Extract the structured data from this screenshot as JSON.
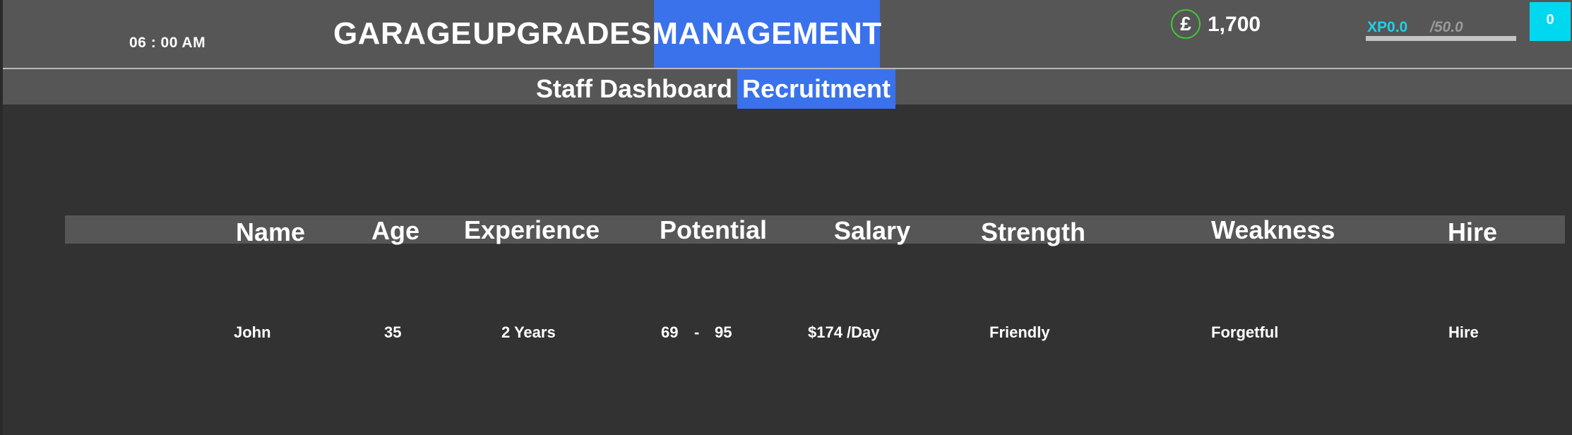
{
  "header": {
    "clock": "06 : 00 AM",
    "nav": [
      {
        "label": "GARAGE",
        "active": false
      },
      {
        "label": "UPGRADES",
        "active": false
      },
      {
        "label": "MANAGEMENT",
        "active": true
      }
    ],
    "currency_symbol": "£",
    "money": "1,700",
    "xp": {
      "label": "XP0.0",
      "max": "/50.0",
      "current": 0.0,
      "total": 50.0
    },
    "level": "0"
  },
  "subnav": [
    {
      "label": "Staff Dashboard",
      "active": false
    },
    {
      "label": "Recruitment",
      "active": true
    }
  ],
  "table": {
    "columns": [
      "Name",
      "Age",
      "Experience",
      "Potential",
      "Salary",
      "Strength",
      "Weakness",
      "Hire"
    ],
    "rows": [
      {
        "name": "John",
        "age": "35",
        "experience": "2 Years",
        "potential_min": "69",
        "potential_sep": "-",
        "potential_max": "95",
        "salary": "$174 /Day",
        "strength": "Friendly",
        "weakness": "Forgetful",
        "hire": "Hire"
      }
    ]
  },
  "colors": {
    "active_tab": "#3a72ec",
    "xp_accent": "#1fd1e6",
    "coin_ring": "#41c934",
    "level_badge": "#00d8f0"
  }
}
